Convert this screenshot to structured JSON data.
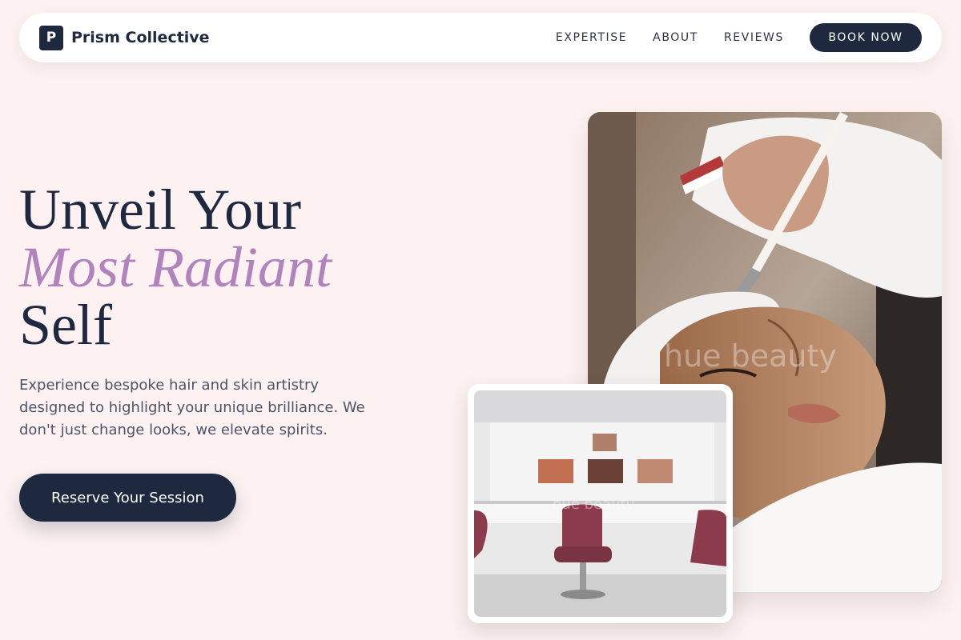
{
  "brand": {
    "logo_letter": "P",
    "name": "Prism Collective"
  },
  "nav": {
    "links": [
      "EXPERTISE",
      "ABOUT",
      "REVIEWS"
    ],
    "cta": "BOOK NOW"
  },
  "hero": {
    "headline_1": "Unveil Your",
    "headline_accent": "Most Radiant",
    "headline_2": "Self",
    "lead": "Experience bespoke hair and skin artistry designed to highlight your unique brilliance. We don't just change looks, we elevate spirits.",
    "cta": "Reserve Your Session"
  },
  "images": {
    "main_watermark": "hue beauty",
    "small_watermark": "hue beauty"
  },
  "colors": {
    "background": "#fdf2f1",
    "navy": "#1e2940",
    "accent": "#b083bd"
  }
}
